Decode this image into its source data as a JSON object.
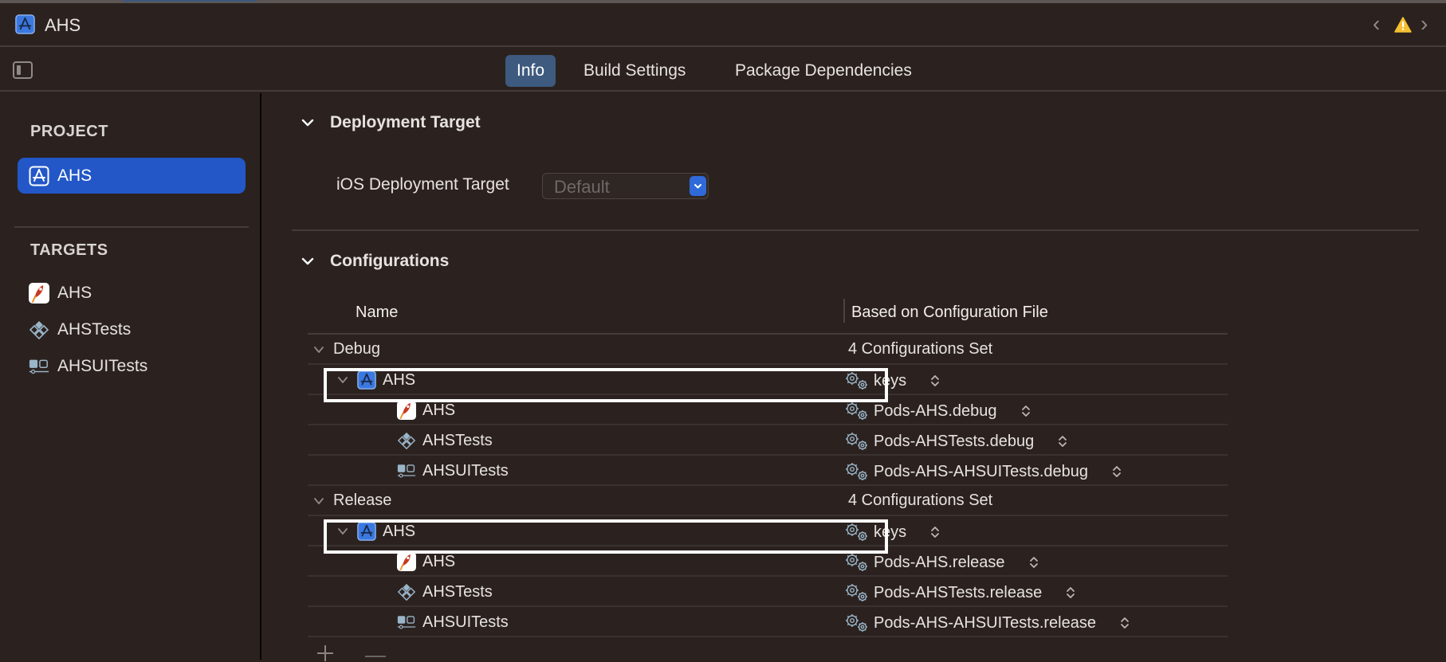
{
  "window": {
    "title": "AHS",
    "nav_back": "‹",
    "nav_forward": "›",
    "warning_icon": "warning-triangle-icon"
  },
  "tabs": [
    {
      "label": "Info",
      "active": true
    },
    {
      "label": "Build Settings",
      "active": false
    },
    {
      "label": "Package Dependencies",
      "active": false
    }
  ],
  "sidebar": {
    "project_heading": "PROJECT",
    "project_items": [
      {
        "label": "AHS",
        "icon": "xcode-project-icon",
        "selected": true
      }
    ],
    "targets_heading": "TARGETS",
    "target_items": [
      {
        "label": "AHS",
        "icon": "app-target-icon"
      },
      {
        "label": "AHSTests",
        "icon": "unit-test-target-icon"
      },
      {
        "label": "AHSUITests",
        "icon": "ui-test-target-icon"
      }
    ]
  },
  "deployment": {
    "section_title": "Deployment Target",
    "label": "iOS Deployment Target",
    "select_value": "Default"
  },
  "configurations": {
    "section_title": "Configurations",
    "columns": {
      "name": "Name",
      "file": "Based on Configuration File"
    },
    "groups": [
      {
        "name": "Debug",
        "summary": "4 Configurations Set",
        "project": {
          "name": "AHS",
          "file": "keys"
        },
        "targets": [
          {
            "name": "AHS",
            "icon": "app-target-icon",
            "file": "Pods-AHS.debug"
          },
          {
            "name": "AHSTests",
            "icon": "unit-test-target-icon",
            "file": "Pods-AHSTests.debug"
          },
          {
            "name": "AHSUITests",
            "icon": "ui-test-target-icon",
            "file": "Pods-AHS-AHSUITests.debug"
          }
        ]
      },
      {
        "name": "Release",
        "summary": "4 Configurations Set",
        "project": {
          "name": "AHS",
          "file": "keys"
        },
        "targets": [
          {
            "name": "AHS",
            "icon": "app-target-icon",
            "file": "Pods-AHS.release"
          },
          {
            "name": "AHSTests",
            "icon": "unit-test-target-icon",
            "file": "Pods-AHSTests.release"
          },
          {
            "name": "AHSUITests",
            "icon": "ui-test-target-icon",
            "file": "Pods-AHS-AHSUITests.release"
          }
        ]
      }
    ],
    "add_label": "+",
    "remove_label": "−"
  },
  "colors": {
    "background": "#2b221f",
    "selection": "#2357c8",
    "active_tab": "#3e5a7e",
    "warning": "#f4c030",
    "highlight_box": "#ffffff"
  }
}
